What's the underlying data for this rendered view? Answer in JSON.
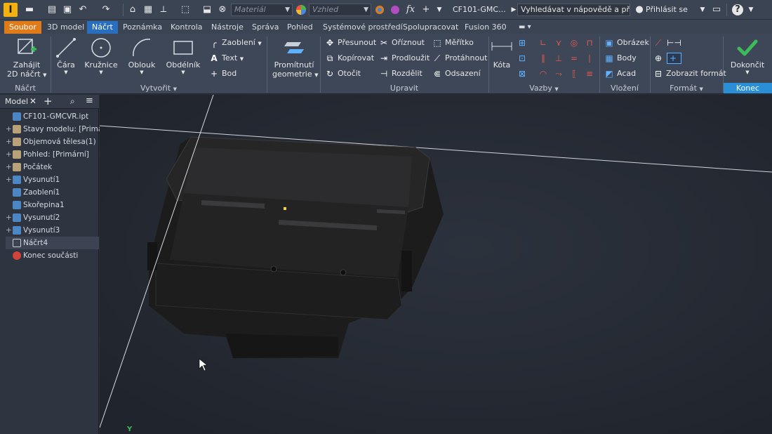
{
  "qat": {
    "logo_letter": "I",
    "material_placeholder": "Materiál",
    "appearance_placeholder": "Vzhled",
    "fx_label": "fx",
    "document_title": "CF101-GMC...",
    "help_search": "Vyhledávat v nápovědě a příkaze",
    "sign_in": "Přihlásit se",
    "help_label": "?"
  },
  "tabs": [
    "Soubor",
    "3D model",
    "Náčrt",
    "Poznámka",
    "Kontrola",
    "Nástroje",
    "Správa",
    "Pohled",
    "Systémové prostředí",
    "Spolupracovat",
    "Fusion 360"
  ],
  "active_tab": "Náčrt",
  "ribbon": {
    "nacrt_panel": {
      "label": "Náčrt",
      "start_line1": "Zahájit",
      "start_line2": "2D náčrt"
    },
    "create_panel": {
      "label": "Vytvořit",
      "line": "Čára",
      "circle": "Kružnice",
      "arc": "Oblouk",
      "rectangle": "Obdélník",
      "fillet": "Zaoblení",
      "text": "Text",
      "point": "Bod",
      "project_line1": "Promítnutí",
      "project_line2": "geometrie"
    },
    "modify_panel": {
      "label": "Upravit",
      "move": "Přesunout",
      "copy": "Kopírovat",
      "rotate": "Otočit",
      "trim": "Oříznout",
      "extend": "Prodloužit",
      "split": "Rozdělit",
      "scale": "Měřítko",
      "stretch": "Protáhnout",
      "offset": "Odsazení"
    },
    "constrain_panel": {
      "label": "Vazby",
      "dimension": "Kóta"
    },
    "insert_panel": {
      "label": "Vložení",
      "image": "Obrázek",
      "points": "Body",
      "acad": "Acad"
    },
    "format_panel": {
      "label": "Formát",
      "show_format": "Zobrazit formát"
    },
    "exit_panel": {
      "label": "Konec",
      "finish": "Dokončit"
    }
  },
  "browser": {
    "tab_label": "Model",
    "items": [
      {
        "label": "CF101-GMCVR.ipt",
        "expandable": false,
        "icon": "part-icon"
      },
      {
        "label": "Stavy modelu: [Primární",
        "expandable": true,
        "icon": "folder-icon"
      },
      {
        "label": "Objemová tělesa(1)",
        "expandable": true,
        "icon": "folder-icon"
      },
      {
        "label": "Pohled: [Primární]",
        "expandable": true,
        "icon": "view-icon"
      },
      {
        "label": "Počátek",
        "expandable": true,
        "icon": "folder-icon"
      },
      {
        "label": "Vysunutí1",
        "expandable": true,
        "icon": "extrude-icon"
      },
      {
        "label": "Zaoblení1",
        "expandable": false,
        "icon": "fillet-icon"
      },
      {
        "label": "Skořepina1",
        "expandable": false,
        "icon": "shell-icon"
      },
      {
        "label": "Vysunutí2",
        "expandable": true,
        "icon": "extrude-icon"
      },
      {
        "label": "Vysunutí3",
        "expandable": true,
        "icon": "extrude-icon"
      },
      {
        "label": "Náčrt4",
        "expandable": false,
        "icon": "sketch-icon"
      },
      {
        "label": "Konec součásti",
        "expandable": false,
        "icon": "end-of-part-icon"
      }
    ]
  },
  "canvas": {
    "axis_label": "Y"
  },
  "colors": {
    "accent": "#2a6fbd",
    "file_tab": "#e07b1a",
    "ribbon_bg": "#3d4758",
    "canvas_bg": "#262b35",
    "finish_check": "#3dbb5a"
  }
}
